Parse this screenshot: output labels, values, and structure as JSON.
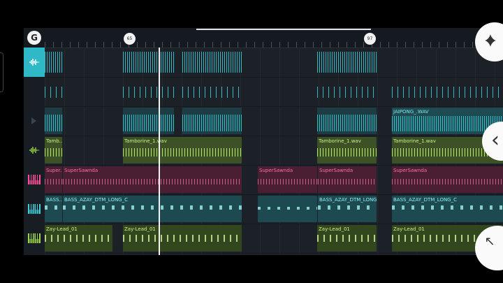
{
  "timeline": {
    "logo_glyph": "G",
    "markers": [
      {
        "label": "65"
      },
      {
        "label": "97"
      }
    ]
  },
  "tracks": [
    {
      "id": "audio1",
      "icon": "waveform-icon",
      "color": "#2fb8c6",
      "active": true
    },
    {
      "id": "audio2",
      "icon": "none",
      "color": "#2fb8c6"
    },
    {
      "id": "audio3",
      "icon": "play-arrow-icon",
      "color": "#2fb8c6"
    },
    {
      "id": "tamborine",
      "icon": "waveform-icon",
      "color": "#9bd64a"
    },
    {
      "id": "supersawnda",
      "icon": "piano-icon",
      "color": "#ff4f9a"
    },
    {
      "id": "bass",
      "icon": "piano-icon",
      "color": "#3fd0dc"
    },
    {
      "id": "lead",
      "icon": "piano-icon",
      "color": "#9bd64a"
    }
  ],
  "clips": {
    "jaipong": {
      "label": "JAIPONG_.WAV"
    },
    "tamborine_short": {
      "label": "Tamb..."
    },
    "tamborine_1": {
      "label": "Tamborine_1.wav"
    },
    "tamborine_2": {
      "label": "Tamborine_1.wav"
    },
    "tamborine_3": {
      "label": "Tamborine_1.wav"
    },
    "super_short": {
      "label": "Super..."
    },
    "super_1": {
      "label": "SuperSawnda"
    },
    "super_2": {
      "label": "SuperSawnda"
    },
    "super_3": {
      "label": "SuperSawnda"
    },
    "super_4": {
      "label": "SuperSawnda"
    },
    "bass_short": {
      "label": "BASS..."
    },
    "bass_1": {
      "label": "BASS_AZAY_DTM_LONG_C"
    },
    "bass_2": {
      "label": "BASS_AZAY_DTM_LONG_C"
    },
    "bass_3": {
      "label": "BASS_AZAY_DTM_LONG_C"
    },
    "bass_4": {
      "label": "BASS_AZAY_DTM_LONG_C"
    },
    "lead_1": {
      "label": "Zay-Lead_01"
    },
    "lead_2": {
      "label": "Zay-Lead_01"
    },
    "lead_3": {
      "label": "Zay-Lead_01"
    },
    "lead_4": {
      "label": "Zay-Lead_01"
    }
  },
  "buttons": {
    "collapse_glyph": "‹",
    "expand_glyph": "↖"
  }
}
